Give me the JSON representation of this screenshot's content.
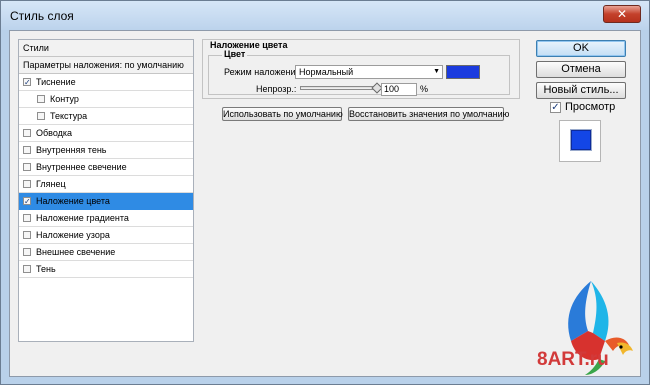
{
  "window": {
    "title": "Стиль слоя",
    "close_label": "✕"
  },
  "styles_list": [
    {
      "label": "Стили",
      "checkbox": null,
      "indent": 0,
      "header": true,
      "selected": false
    },
    {
      "label": "Параметры наложения: по умолчанию",
      "checkbox": null,
      "indent": 0,
      "header": true,
      "selected": false
    },
    {
      "label": "Тиснение",
      "checkbox": true,
      "indent": 0,
      "header": false,
      "selected": false
    },
    {
      "label": "Контур",
      "checkbox": false,
      "indent": 1,
      "header": false,
      "selected": false
    },
    {
      "label": "Текстура",
      "checkbox": false,
      "indent": 1,
      "header": false,
      "selected": false
    },
    {
      "label": "Обводка",
      "checkbox": false,
      "indent": 0,
      "header": false,
      "selected": false
    },
    {
      "label": "Внутренняя тень",
      "checkbox": false,
      "indent": 0,
      "header": false,
      "selected": false
    },
    {
      "label": "Внутреннее свечение",
      "checkbox": false,
      "indent": 0,
      "header": false,
      "selected": false
    },
    {
      "label": "Глянец",
      "checkbox": false,
      "indent": 0,
      "header": false,
      "selected": false
    },
    {
      "label": "Наложение цвета",
      "checkbox": true,
      "indent": 0,
      "header": false,
      "selected": true
    },
    {
      "label": "Наложение градиента",
      "checkbox": false,
      "indent": 0,
      "header": false,
      "selected": false
    },
    {
      "label": "Наложение узора",
      "checkbox": false,
      "indent": 0,
      "header": false,
      "selected": false
    },
    {
      "label": "Внешнее свечение",
      "checkbox": false,
      "indent": 0,
      "header": false,
      "selected": false
    },
    {
      "label": "Тень",
      "checkbox": false,
      "indent": 0,
      "header": false,
      "selected": false
    }
  ],
  "color_overlay": {
    "group_title": "Наложение цвета",
    "subgroup_title": "Цвет",
    "blend_mode_label": "Режим наложения:",
    "blend_mode_value": "Нормальный",
    "color": "#1b3bde",
    "opacity_label": "Непрозр.:",
    "opacity_value": "100",
    "opacity_unit": "%",
    "opacity_fraction": 1.0,
    "make_default_label": "Использовать по умолчанию",
    "reset_default_label": "Восстановить значения по умолчанию"
  },
  "actions": {
    "ok_label": "OK",
    "cancel_label": "Отмена",
    "new_style_label": "Новый стиль...",
    "preview_label": "Просмотр",
    "preview_checked": true,
    "preview_color": "#1346e6"
  },
  "watermark": {
    "text": "8ART.ru"
  }
}
